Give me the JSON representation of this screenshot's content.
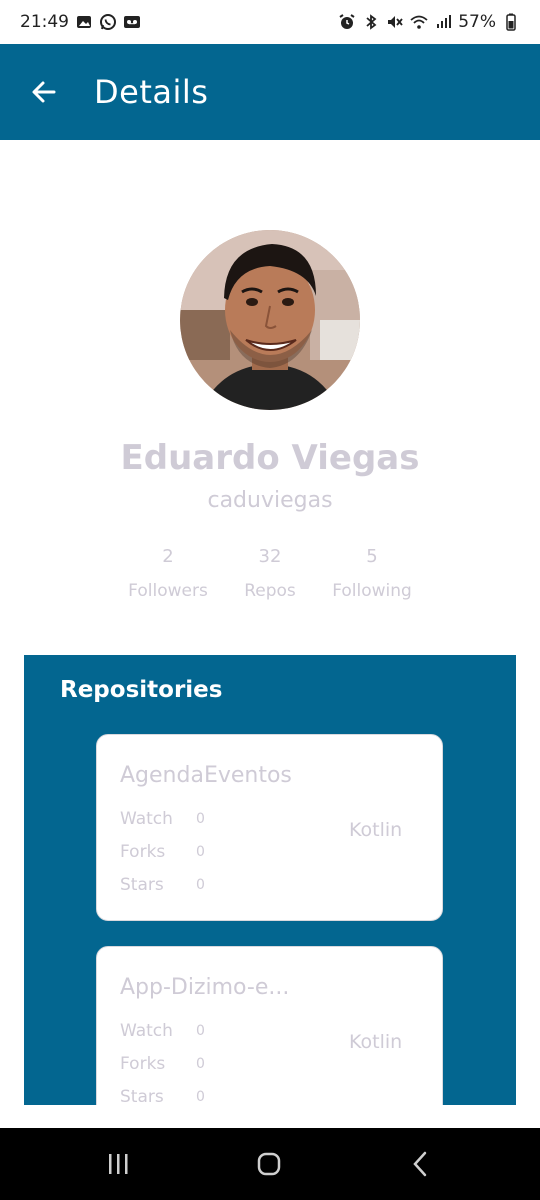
{
  "status_bar": {
    "time": "21:49",
    "battery": "57%",
    "left_icons": [
      "gallery-icon",
      "whatsapp-icon",
      "voicemail-icon"
    ],
    "right_icons": [
      "alarm-icon",
      "bluetooth-icon",
      "mute-icon",
      "wifi-icon",
      "signal-icon",
      "battery-icon"
    ]
  },
  "app_bar": {
    "title": "Details",
    "color": "#036690"
  },
  "profile": {
    "name": "Eduardo Viegas",
    "username": "caduviegas",
    "stats": [
      {
        "value": "2",
        "label": "Followers"
      },
      {
        "value": "32",
        "label": "Repos"
      },
      {
        "value": "5",
        "label": "Following"
      }
    ]
  },
  "repositories": {
    "title": "Repositories",
    "items": [
      {
        "name": "AgendaEventos",
        "watch_label": "Watch",
        "watch": "0",
        "forks_label": "Forks",
        "forks": "0",
        "stars_label": "Stars",
        "stars": "0",
        "language": "Kotlin"
      },
      {
        "name": "App-Dizimo-e...",
        "watch_label": "Watch",
        "watch": "0",
        "forks_label": "Forks",
        "forks": "0",
        "stars_label": "Stars",
        "stars": "0",
        "language": "Kotlin"
      }
    ]
  },
  "nav_bar": {
    "buttons": [
      "recents-icon",
      "home-icon",
      "back-nav-icon"
    ]
  }
}
